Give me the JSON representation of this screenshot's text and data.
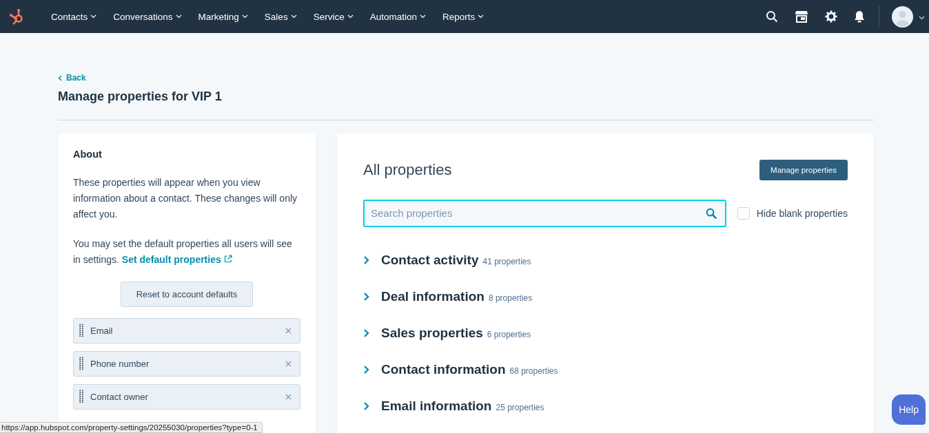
{
  "nav": {
    "items": [
      {
        "label": "Contacts"
      },
      {
        "label": "Conversations"
      },
      {
        "label": "Marketing"
      },
      {
        "label": "Sales"
      },
      {
        "label": "Service"
      },
      {
        "label": "Automation"
      },
      {
        "label": "Reports"
      }
    ]
  },
  "page": {
    "back": "Back",
    "title": "Manage properties for VIP 1"
  },
  "about": {
    "heading": "About",
    "paragraph_1": "These properties will appear when you view information about a contact. These changes will only affect you.",
    "paragraph_2": "You may set the default properties all users will see in settings.",
    "link": "Set default properties",
    "reset_button": "Reset to account defaults",
    "properties": [
      {
        "label": "Email"
      },
      {
        "label": "Phone number"
      },
      {
        "label": "Contact owner"
      }
    ]
  },
  "all_properties": {
    "heading": "All properties",
    "manage_button": "Manage properties",
    "search": {
      "placeholder": "Search properties"
    },
    "hide_blank": {
      "label": "Hide blank properties",
      "checked": false
    },
    "groups": [
      {
        "name": "Contact activity",
        "count": "41 properties",
        "expanded": false
      },
      {
        "name": "Deal information",
        "count": "8 properties",
        "expanded": false
      },
      {
        "name": "Sales properties",
        "count": "6 properties",
        "expanded": false
      },
      {
        "name": "Contact information",
        "count": "68 properties",
        "expanded": false
      },
      {
        "name": "Email information",
        "count": "25 properties",
        "expanded": false
      }
    ]
  },
  "status_url": "https://app.hubspot.com/property-settings/20255030/properties?type=0-1",
  "help_button": "Help"
}
